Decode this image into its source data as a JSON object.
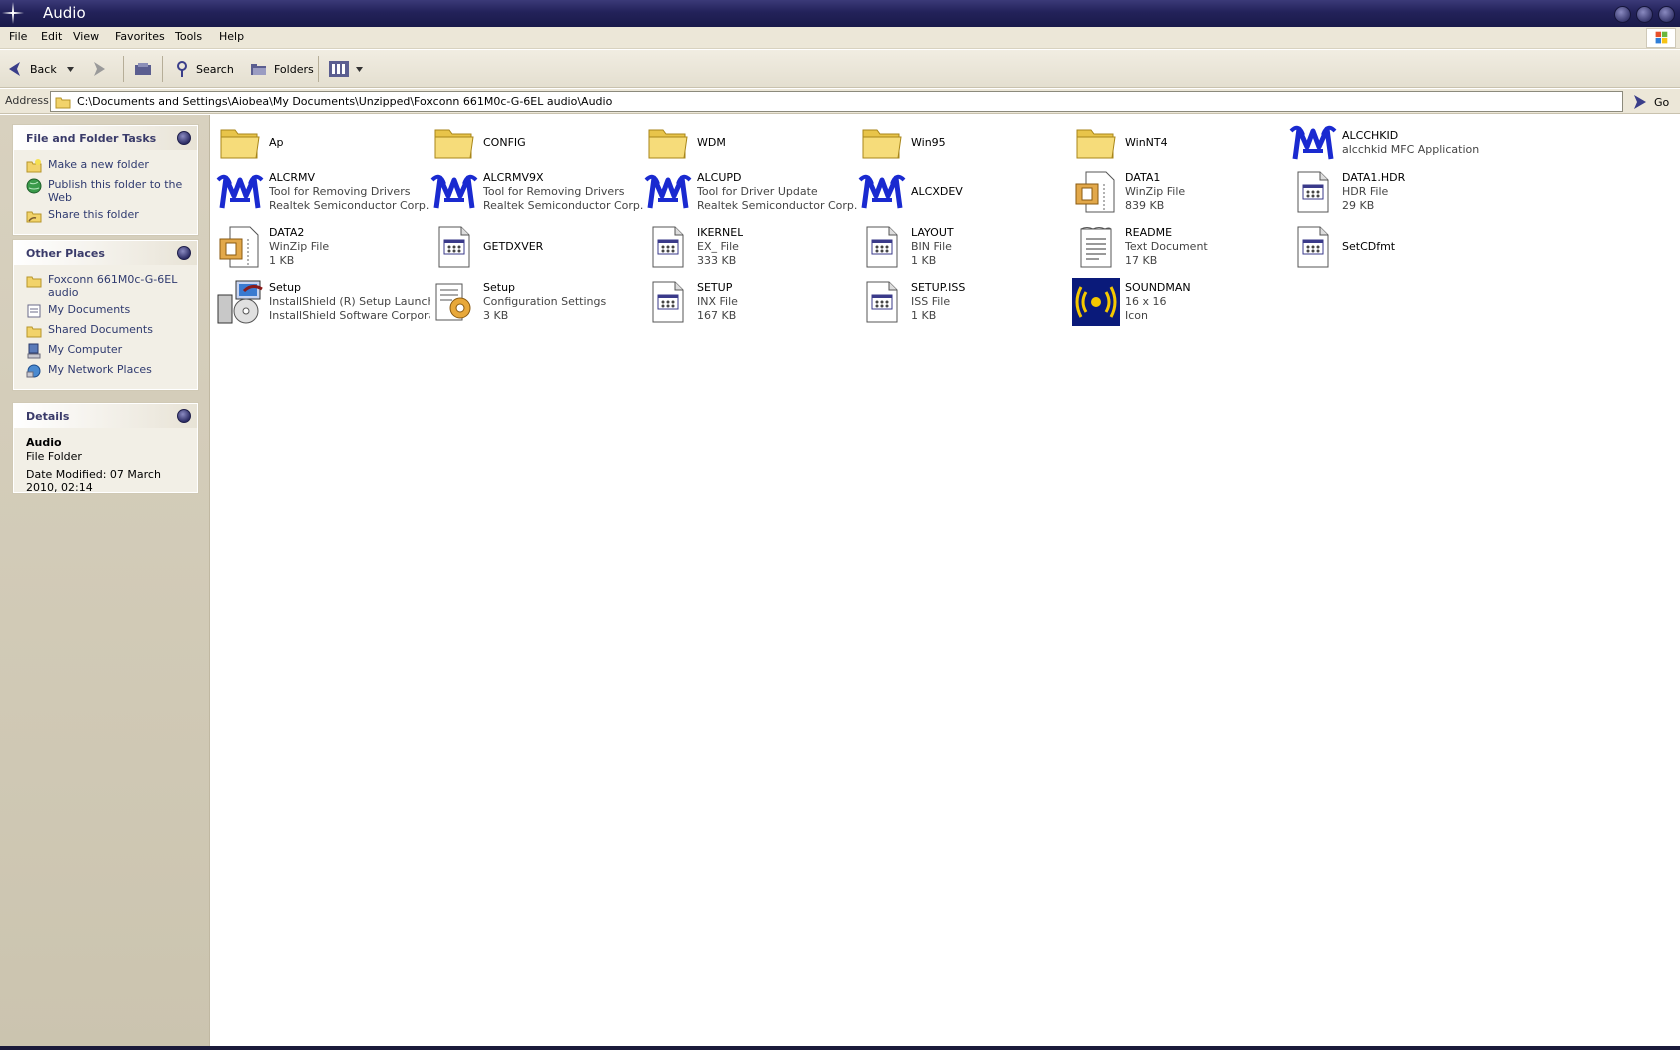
{
  "window": {
    "title": "Audio"
  },
  "menu": [
    "File",
    "Edit",
    "View",
    "Favorites",
    "Tools",
    "Help"
  ],
  "toolbar": {
    "back_label": "Back",
    "search_label": "Search",
    "folders_label": "Folders"
  },
  "address": {
    "label": "Address",
    "path": "C:\\Documents and Settings\\Aiobea\\My Documents\\Unzipped\\Foxconn 661M0c-G-6EL audio\\Audio",
    "go_label": "Go"
  },
  "tasks": {
    "title": "File and Folder Tasks",
    "items": [
      "Make a new folder",
      "Publish this folder to the Web",
      "Share this folder"
    ]
  },
  "places": {
    "title": "Other Places",
    "items": [
      "Foxconn 661M0c-G-6EL audio",
      "My Documents",
      "Shared Documents",
      "My Computer",
      "My Network Places"
    ]
  },
  "details": {
    "title": "Details",
    "name": "Audio",
    "type": "File Folder",
    "modified": "Date Modified: 07 March 2010, 02:14"
  },
  "files": [
    {
      "name": "Ap",
      "line2": "",
      "line3": "",
      "icon": "folder-icon"
    },
    {
      "name": "CONFIG",
      "line2": "",
      "line3": "",
      "icon": "folder-icon"
    },
    {
      "name": "WDM",
      "line2": "",
      "line3": "",
      "icon": "folder-icon"
    },
    {
      "name": "Win95",
      "line2": "",
      "line3": "",
      "icon": "folder-icon"
    },
    {
      "name": "WinNT4",
      "line2": "",
      "line3": "",
      "icon": "folder-icon"
    },
    {
      "name": "ALCCHKID",
      "line2": "alcchkid MFC Application",
      "line3": "",
      "icon": "realtek-icon"
    },
    {
      "name": "ALCRMV",
      "line2": "Tool for Removing Drivers",
      "line3": "Realtek Semiconductor Corp.",
      "icon": "realtek-icon"
    },
    {
      "name": "ALCRMV9X",
      "line2": "Tool for Removing Drivers",
      "line3": "Realtek Semiconductor Corp.",
      "icon": "realtek-icon"
    },
    {
      "name": "ALCUPD",
      "line2": "Tool for Driver Update",
      "line3": "Realtek Semiconductor Corp.",
      "icon": "realtek-icon"
    },
    {
      "name": "ALCXDEV",
      "line2": "",
      "line3": "",
      "icon": "realtek-icon"
    },
    {
      "name": "DATA1",
      "line2": "WinZip File",
      "line3": "839 KB",
      "icon": "winzip-icon"
    },
    {
      "name": "DATA1.HDR",
      "line2": "HDR File",
      "line3": "29 KB",
      "icon": "generic-file-icon"
    },
    {
      "name": "DATA2",
      "line2": "WinZip File",
      "line3": "1 KB",
      "icon": "winzip-icon"
    },
    {
      "name": "GETDXVER",
      "line2": "",
      "line3": "",
      "icon": "generic-file-icon"
    },
    {
      "name": "IKERNEL",
      "line2": "EX_ File",
      "line3": "333 KB",
      "icon": "generic-file-icon"
    },
    {
      "name": "LAYOUT",
      "line2": "BIN File",
      "line3": "1 KB",
      "icon": "generic-file-icon"
    },
    {
      "name": "README",
      "line2": "Text Document",
      "line3": "17 KB",
      "icon": "text-document-icon"
    },
    {
      "name": "SetCDfmt",
      "line2": "",
      "line3": "",
      "icon": "generic-file-icon"
    },
    {
      "name": "Setup",
      "line2": "InstallShield (R) Setup Launcher",
      "line3": "InstallShield Software Corpora...",
      "icon": "installer-icon"
    },
    {
      "name": "Setup",
      "line2": "Configuration Settings",
      "line3": "3 KB",
      "icon": "config-settings-icon"
    },
    {
      "name": "SETUP",
      "line2": "INX File",
      "line3": "167 KB",
      "icon": "generic-file-icon"
    },
    {
      "name": "SETUP.ISS",
      "line2": "ISS File",
      "line3": "1 KB",
      "icon": "generic-file-icon"
    },
    {
      "name": "SOUNDMAN",
      "line2": "16 x 16",
      "line3": "Icon",
      "icon": "sound-icon"
    }
  ]
}
